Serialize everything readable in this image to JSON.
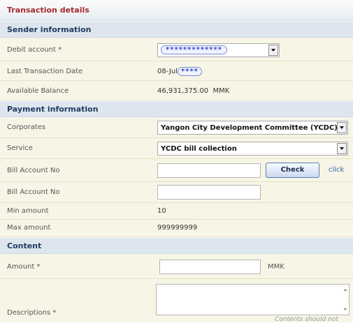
{
  "title": "Transaction details",
  "sender": {
    "header": "Sender information",
    "debit_account": {
      "label": "Debit account *",
      "value": "*************"
    },
    "last_transaction": {
      "label": "Last Transaction Date",
      "prefix": "08-Jul",
      "masked": "****"
    },
    "balance": {
      "label": "Available Balance",
      "value": "46,931,375.00",
      "currency": "MMK"
    }
  },
  "payment": {
    "header": "Payment information",
    "corporates": {
      "label": "Corporates",
      "value": "Yangon City Development Committee (YCDC)"
    },
    "service": {
      "label": "Service",
      "value": "YCDC bill collection"
    },
    "bill_account_1": {
      "label": "Bill Account No",
      "value": ""
    },
    "check_label": "Check",
    "click_label": "click",
    "bill_account_2": {
      "label": "Bill Account No",
      "value": ""
    },
    "min_amount": {
      "label": "Min amount",
      "value": "10"
    },
    "max_amount": {
      "label": "Max amount",
      "value": "999999999"
    }
  },
  "content": {
    "header": "Content",
    "amount": {
      "label": "Amount *",
      "value": "",
      "currency": "MMK"
    },
    "descriptions": {
      "label": "Descriptions *",
      "value": "",
      "hint": "Contents should not"
    }
  },
  "colors": {
    "title": "#a52a2a",
    "section_header_bg": "#dde6ef",
    "row_bg": "#f7f5e6",
    "masked_text": "#3344cc"
  }
}
